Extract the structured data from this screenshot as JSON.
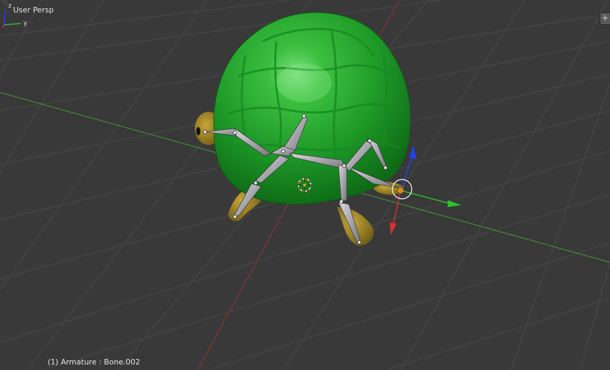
{
  "viewport": {
    "view_label": "User Persp",
    "status_label": "(1) Armature : Bone.002",
    "add_panel_button": "+"
  },
  "nav_axes": {
    "z_label": "z",
    "y_label": "y"
  },
  "colors": {
    "background": "#393939",
    "grid": "#494949",
    "x_axis": "#a03030",
    "y_axis": "#4a9c3a",
    "shell": "#1f9a2a",
    "body": "#a28a2a",
    "bone": "#a8a8ae",
    "manip_x": "#d83030",
    "manip_y": "#2bc02b",
    "manip_z": "#2040ff"
  },
  "icons": [
    "3d-cursor-icon",
    "transform-manipulator-icon",
    "axis-gizmo-icon",
    "plus-icon"
  ]
}
